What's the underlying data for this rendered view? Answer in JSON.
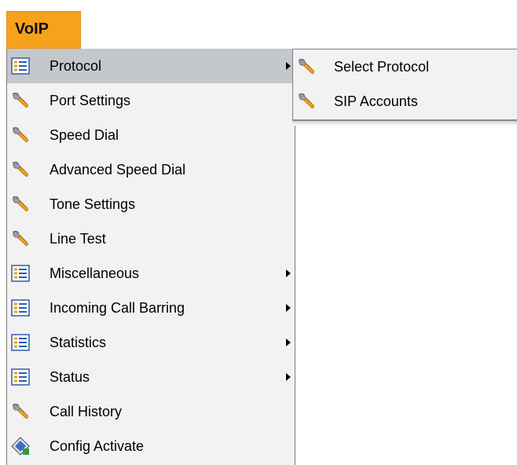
{
  "header": {
    "title": "VoIP"
  },
  "main_menu": {
    "items": [
      {
        "label": "Protocol",
        "icon": "list-icon",
        "submenu": true,
        "selected": true
      },
      {
        "label": "Port Settings",
        "icon": "wrench-icon",
        "submenu": false
      },
      {
        "label": "Speed Dial",
        "icon": "wrench-icon",
        "submenu": false
      },
      {
        "label": "Advanced Speed Dial",
        "icon": "wrench-icon",
        "submenu": false
      },
      {
        "label": "Tone Settings",
        "icon": "wrench-icon",
        "submenu": false
      },
      {
        "label": "Line Test",
        "icon": "wrench-icon",
        "submenu": false
      },
      {
        "label": "Miscellaneous",
        "icon": "list-icon",
        "submenu": true
      },
      {
        "label": "Incoming Call Barring",
        "icon": "list-icon",
        "submenu": true
      },
      {
        "label": "Statistics",
        "icon": "list-icon",
        "submenu": true
      },
      {
        "label": "Status",
        "icon": "list-icon",
        "submenu": true
      },
      {
        "label": "Call History",
        "icon": "wrench-icon",
        "submenu": false
      },
      {
        "label": "Config Activate",
        "icon": "config-activate-icon",
        "submenu": false
      }
    ]
  },
  "sub_menu": {
    "items": [
      {
        "label": "Select Protocol",
        "icon": "wrench-icon"
      },
      {
        "label": "SIP Accounts",
        "icon": "wrench-icon"
      }
    ]
  },
  "colors": {
    "tab_background": "#f7a21c",
    "menu_background": "#f2f2f2",
    "selected_background": "#c3c8cd"
  }
}
